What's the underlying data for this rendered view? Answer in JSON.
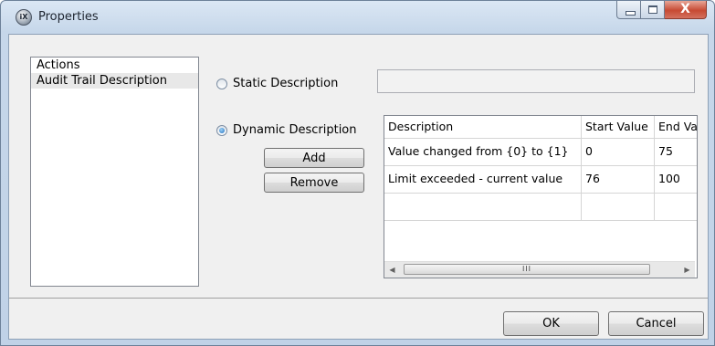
{
  "window": {
    "title": "Properties",
    "icon": "ix-app-icon"
  },
  "caption_buttons": {
    "close_glyph": "X"
  },
  "left_list": {
    "items": [
      {
        "label": "Actions",
        "selected": false
      },
      {
        "label": "Audit Trail Description",
        "selected": true
      }
    ]
  },
  "static_description": {
    "label": "Static Description",
    "checked": false,
    "value": ""
  },
  "dynamic_description": {
    "label": "Dynamic Description",
    "checked": true
  },
  "buttons": {
    "add": "Add",
    "remove": "Remove",
    "ok": "OK",
    "cancel": "Cancel"
  },
  "grid": {
    "columns": [
      "Description",
      "Start Value",
      "End Value"
    ],
    "rows": [
      [
        "Value changed from {0} to {1}",
        "0",
        "75"
      ],
      [
        "Limit exceeded - current value",
        "76",
        "100"
      ]
    ],
    "scroll_thumb_glyph": "III"
  },
  "colors": {
    "accent_radio": "#1f6fbd",
    "close_button": "#c74a33",
    "titlebar": "#c6d7ea"
  }
}
